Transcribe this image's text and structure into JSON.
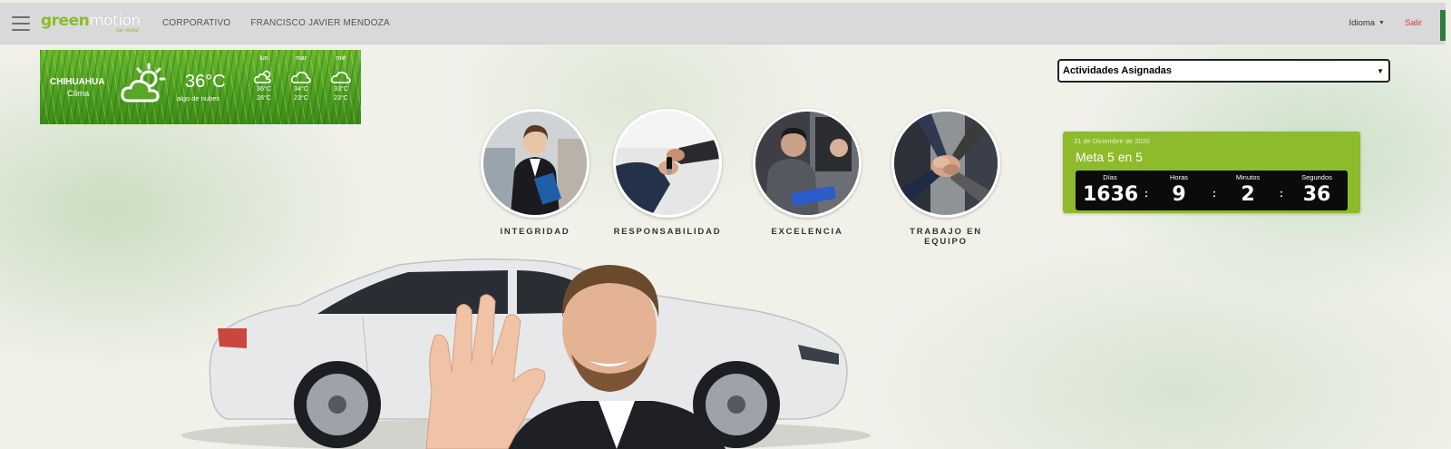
{
  "app": {
    "logo_primary": "green",
    "logo_secondary": "motion",
    "logo_tagline": "car rental",
    "nav": [
      "CORPORATIVO",
      "FRANCISCO JAVIER MENDOZA"
    ],
    "language_label": "Idioma",
    "logout_label": "Salir",
    "menu_icon": "hamburger-icon"
  },
  "weather": {
    "city": "CHIHUAHUA",
    "label": "Clima",
    "temperature": "36°C",
    "condition": "algo de nubes",
    "icon": "partly-cloudy-icon",
    "forecast": [
      {
        "day": "lun",
        "high": "36°C",
        "low": "26°C",
        "icon": "partly-cloudy-icon"
      },
      {
        "day": "mar",
        "high": "34°C",
        "low": "23°C",
        "icon": "cloud-icon"
      },
      {
        "day": "mié",
        "high": "33°C",
        "low": "23°C",
        "icon": "cloud-icon"
      }
    ]
  },
  "values": [
    {
      "label": "INTEGRIDAD",
      "image": "businesswoman-photo"
    },
    {
      "label": "RESPONSABILIDAD",
      "image": "key-handover-photo"
    },
    {
      "label": "EXCELENCIA",
      "image": "car-inspection-photo"
    },
    {
      "label": "TRABAJO EN EQUIPO",
      "image": "team-hands-photo"
    }
  ],
  "activities": {
    "selected": "Actividades Asignadas"
  },
  "countdown": {
    "date": "31 de Diciembre de 2020",
    "title": "Meta 5 en 5",
    "units": [
      {
        "label": "Días",
        "value": "1636"
      },
      {
        "label": "Horas",
        "value": "9"
      },
      {
        "label": "Minutos",
        "value": "2"
      },
      {
        "label": "Segundos",
        "value": "36"
      }
    ]
  },
  "colors": {
    "brand_green": "#8dbb2b",
    "topbar": "#d9d9d9",
    "logout_red": "#d23b3b",
    "timer_bg": "#0b0b0b"
  }
}
